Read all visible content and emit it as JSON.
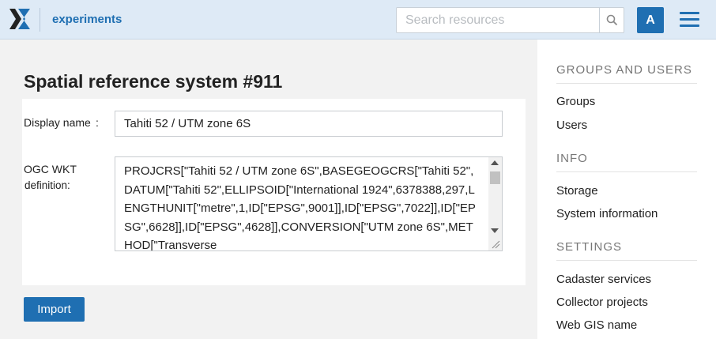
{
  "header": {
    "app_title": "experiments",
    "search_placeholder": "Search resources",
    "avatar_letter": "A",
    "icons": {
      "logo": "x-logo",
      "search": "search-icon",
      "menu": "hamburger-menu-icon"
    },
    "colors": {
      "bar": "#deeaf6",
      "accent": "#1f6fb2"
    }
  },
  "main": {
    "page_title": "Spatial reference system #911",
    "display_name_label": "Display name",
    "display_name_colon": ":",
    "display_name_value": "Tahiti 52 / UTM zone 6S",
    "wkt_label_line1": "OGC WKT",
    "wkt_label_line2": "definition:",
    "wkt_value": "PROJCRS[\"Tahiti 52 / UTM zone 6S\",BASEGEOGCRS[\"Tahiti 52\",DATUM[\"Tahiti 52\",ELLIPSOID[\"International 1924\",6378388,297,LENGTHUNIT[\"metre\",1,ID[\"EPSG\",9001]],ID[\"EPSG\",7022]],ID[\"EPSG\",6628]],ID[\"EPSG\",4628]],CONVERSION[\"UTM zone 6S\",METHOD[\"Transverse",
    "import_label": "Import"
  },
  "sidebar": {
    "sections": [
      {
        "title": "GROUPS AND USERS",
        "items": [
          "Groups",
          "Users"
        ]
      },
      {
        "title": "INFO",
        "items": [
          "Storage",
          "System information"
        ]
      },
      {
        "title": "SETTINGS",
        "items": [
          "Cadaster services",
          "Collector projects",
          "Web GIS name"
        ]
      }
    ]
  }
}
